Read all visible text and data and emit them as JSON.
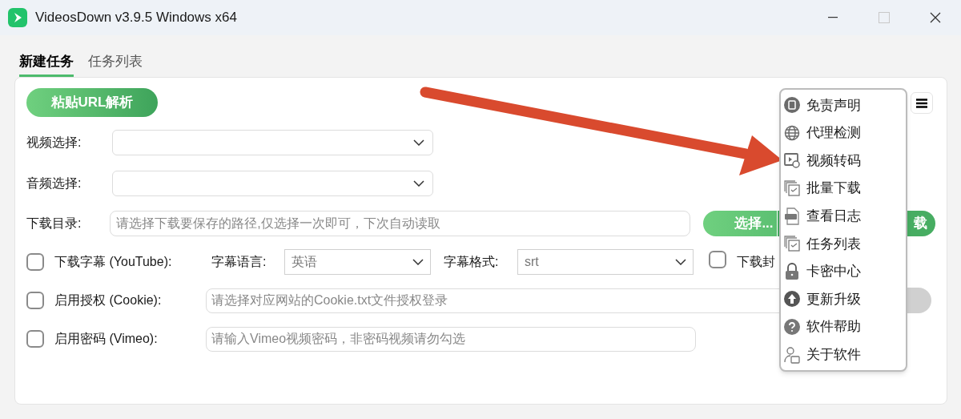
{
  "window": {
    "title": "VideosDown v3.9.5 Windows x64",
    "maximize_disabled": true
  },
  "tabs": [
    {
      "label": "新建任务",
      "selected": true
    },
    {
      "label": "任务列表",
      "selected": false
    }
  ],
  "paste_button": "粘贴URL解析",
  "video_select": {
    "label": "视频选择:"
  },
  "audio_select": {
    "label": "音频选择:"
  },
  "download_dir": {
    "label": "下载目录:",
    "placeholder": "请选择下载要保存的路径,仅选择一次即可，下次自动读取"
  },
  "select_button": "选择...",
  "download_button": "载",
  "subtitles": {
    "label": "下载字幕 (YouTube):",
    "checked": false,
    "language_label": "字幕语言:",
    "language_value": "英语",
    "format_label": "字幕格式:",
    "format_value": "srt"
  },
  "cover": {
    "label": "下载封",
    "checked": false
  },
  "cookie": {
    "label": "启用授权 (Cookie):",
    "checked": false,
    "placeholder": "请选择对应网站的Cookie.txt文件授权登录"
  },
  "vimeo": {
    "label": "启用密码 (Vimeo):",
    "checked": false,
    "placeholder": "请输入Vimeo视频密码，非密码视频请勿勾选"
  },
  "menu": {
    "items": [
      {
        "label": "免责声明",
        "kind": "document"
      },
      {
        "label": "代理检测",
        "kind": "globe"
      },
      {
        "label": "视频转码",
        "kind": "convert"
      },
      {
        "label": "批量下载",
        "kind": "copy"
      },
      {
        "label": "查看日志",
        "kind": "log"
      },
      {
        "label": "任务列表",
        "kind": "copy"
      },
      {
        "label": "卡密中心",
        "kind": "lock"
      },
      {
        "label": "更新升级",
        "kind": "upload"
      },
      {
        "label": "软件帮助",
        "kind": "help"
      },
      {
        "label": "关于软件",
        "kind": "user"
      }
    ]
  }
}
